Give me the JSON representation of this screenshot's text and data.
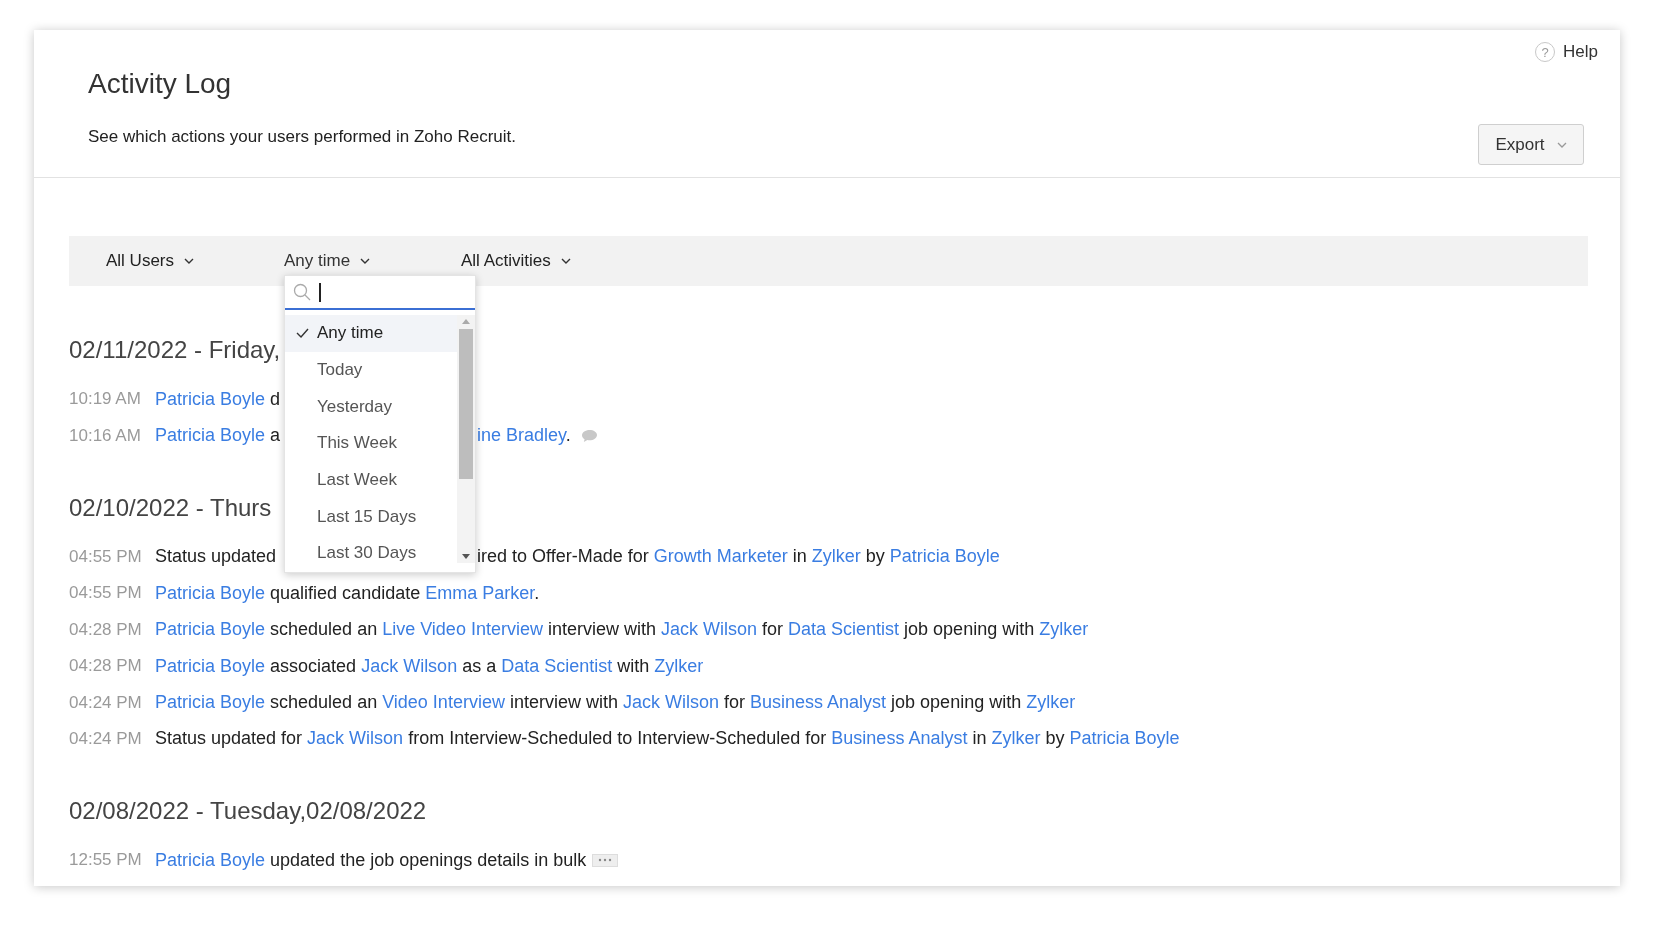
{
  "help": {
    "icon": "?",
    "label": "Help"
  },
  "header": {
    "title": "Activity Log",
    "subtitle": "See which actions your users performed in Zoho Recruit.",
    "export_button": "Export"
  },
  "filters": [
    {
      "label": "All Users",
      "open": false
    },
    {
      "label": "Any time",
      "open": true
    },
    {
      "label": "All Activities",
      "open": false
    }
  ],
  "time_dropdown": {
    "options": [
      {
        "label": "Any time",
        "selected": true
      },
      {
        "label": "Today",
        "selected": false
      },
      {
        "label": "Yesterday",
        "selected": false
      },
      {
        "label": "This Week",
        "selected": false
      },
      {
        "label": "Last Week",
        "selected": false
      },
      {
        "label": "Last 15 Days",
        "selected": false
      },
      {
        "label": "Last 30 Days",
        "selected": false
      }
    ]
  },
  "groups": [
    {
      "heading": "02/11/2022 - Friday,",
      "entries": [
        {
          "time": "10:19 AM",
          "parts": [
            {
              "kind": "link",
              "text": "Patricia Boyle"
            },
            {
              "kind": "text",
              "text": " d"
            }
          ]
        },
        {
          "time": "10:16 AM",
          "parts": [
            {
              "kind": "link",
              "text": "Patricia Boyle"
            },
            {
              "kind": "text",
              "text": " a"
            }
          ],
          "parts_right": [
            {
              "kind": "link",
              "text": "ine Bradley"
            },
            {
              "kind": "text",
              "text": "."
            }
          ],
          "comment": true
        }
      ]
    },
    {
      "heading": "02/10/2022 - Thurs",
      "entries": [
        {
          "time": "04:55 PM",
          "parts": [
            {
              "kind": "text",
              "text": "Status updated"
            }
          ],
          "parts_right": [
            {
              "kind": "text",
              "text": "ired to Offer-Made for "
            },
            {
              "kind": "link",
              "text": "Growth Marketer"
            },
            {
              "kind": "text",
              "text": " in "
            },
            {
              "kind": "link",
              "text": "Zylker"
            },
            {
              "kind": "text",
              "text": " by "
            },
            {
              "kind": "link",
              "text": "Patricia Boyle"
            }
          ]
        },
        {
          "time": "04:55 PM",
          "parts": [
            {
              "kind": "link",
              "text": "Patricia Boyle"
            },
            {
              "kind": "text",
              "text": " qualified candidate "
            },
            {
              "kind": "link",
              "text": "Emma Parker"
            },
            {
              "kind": "text",
              "text": "."
            }
          ]
        },
        {
          "time": "04:28 PM",
          "parts": [
            {
              "kind": "link",
              "text": "Patricia Boyle"
            },
            {
              "kind": "text",
              "text": " scheduled an "
            },
            {
              "kind": "link",
              "text": "Live Video Interview"
            },
            {
              "kind": "text",
              "text": " interview with "
            },
            {
              "kind": "link",
              "text": "Jack Wilson"
            },
            {
              "kind": "text",
              "text": " for "
            },
            {
              "kind": "link",
              "text": "Data Scientist"
            },
            {
              "kind": "text",
              "text": " job opening with "
            },
            {
              "kind": "link",
              "text": "Zylker"
            }
          ]
        },
        {
          "time": "04:28 PM",
          "parts": [
            {
              "kind": "link",
              "text": "Patricia Boyle"
            },
            {
              "kind": "text",
              "text": " associated "
            },
            {
              "kind": "link",
              "text": "Jack Wilson"
            },
            {
              "kind": "text",
              "text": " as a "
            },
            {
              "kind": "link",
              "text": "Data Scientist"
            },
            {
              "kind": "text",
              "text": " with "
            },
            {
              "kind": "link",
              "text": "Zylker"
            }
          ]
        },
        {
          "time": "04:24 PM",
          "parts": [
            {
              "kind": "link",
              "text": "Patricia Boyle"
            },
            {
              "kind": "text",
              "text": " scheduled an "
            },
            {
              "kind": "link",
              "text": "Video Interview"
            },
            {
              "kind": "text",
              "text": " interview with "
            },
            {
              "kind": "link",
              "text": "Jack Wilson"
            },
            {
              "kind": "text",
              "text": " for "
            },
            {
              "kind": "link",
              "text": "Business Analyst"
            },
            {
              "kind": "text",
              "text": " job opening with "
            },
            {
              "kind": "link",
              "text": "Zylker"
            }
          ]
        },
        {
          "time": "04:24 PM",
          "parts": [
            {
              "kind": "text",
              "text": "Status updated for "
            },
            {
              "kind": "link",
              "text": "Jack Wilson"
            },
            {
              "kind": "text",
              "text": " from Interview-Scheduled to Interview-Scheduled for "
            },
            {
              "kind": "link",
              "text": "Business Analyst"
            },
            {
              "kind": "text",
              "text": " in "
            },
            {
              "kind": "link",
              "text": "Zylker"
            },
            {
              "kind": "text",
              "text": " by "
            },
            {
              "kind": "link",
              "text": "Patricia Boyle"
            }
          ]
        }
      ]
    },
    {
      "heading": "02/08/2022 - Tuesday,02/08/2022",
      "entries": [
        {
          "time": "12:55 PM",
          "parts": [
            {
              "kind": "link",
              "text": "Patricia Boyle"
            },
            {
              "kind": "text",
              "text": " updated the job openings details in bulk"
            }
          ],
          "more": true
        }
      ]
    }
  ]
}
